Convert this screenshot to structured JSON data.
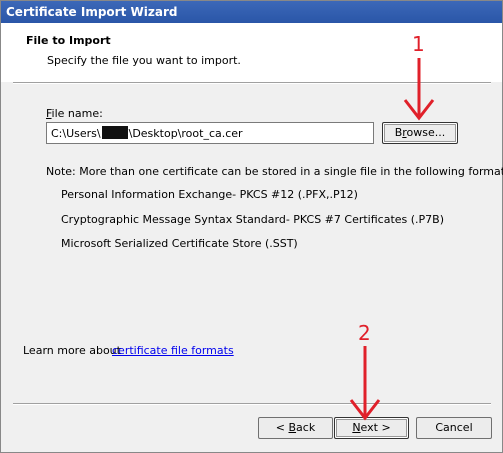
{
  "window": {
    "title": "Certificate Import Wizard"
  },
  "header": {
    "title": "File to Import",
    "subtitle": "Specify the file you want to import."
  },
  "file": {
    "label": "File name:",
    "label_accel": "F",
    "label_rest": "ile name:",
    "value_prefix": "C:\\Users\\",
    "value_suffix": "\\Desktop\\root_ca.cer",
    "browse_label": "Browse...",
    "browse_accel": "r",
    "browse_pre": "B",
    "browse_post": "owse..."
  },
  "note": {
    "intro": "Note:  More than one certificate can be stored in a single file in the following formats:",
    "formats": [
      "Personal Information Exchange- PKCS #12 (.PFX,.P12)",
      "Cryptographic Message Syntax Standard- PKCS #7 Certificates (.P7B)",
      "Microsoft Serialized Certificate Store (.SST)"
    ]
  },
  "learn_more": {
    "text": "Learn more about",
    "link": "certificate file formats"
  },
  "buttons": {
    "back": "< Back",
    "back_pre": "< ",
    "back_accel": "B",
    "back_post": "ack",
    "next": "Next >",
    "next_accel": "N",
    "next_post": "ext >",
    "cancel": "Cancel"
  },
  "annotations": {
    "label_1": "1",
    "label_2": "2",
    "color": "#e0202a"
  }
}
